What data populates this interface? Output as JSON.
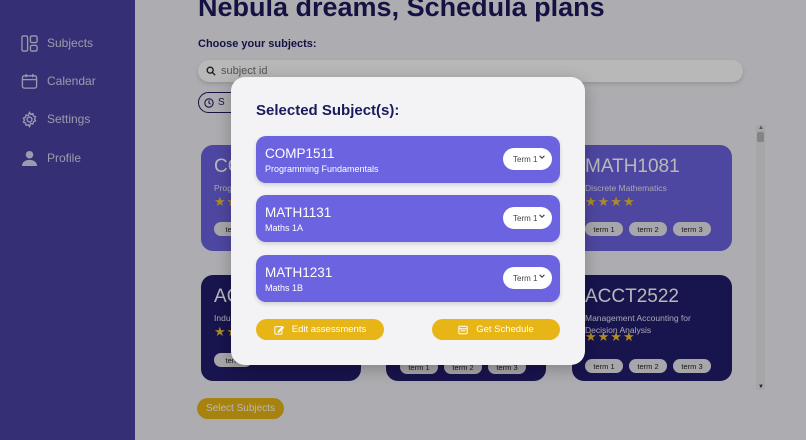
{
  "sidebar": {
    "items": [
      {
        "label": "Subjects",
        "icon": "layout-icon"
      },
      {
        "label": "Calendar",
        "icon": "calendar-icon"
      },
      {
        "label": "Settings",
        "icon": "gear-icon"
      },
      {
        "label": "Profile",
        "icon": "user-icon"
      }
    ]
  },
  "main": {
    "title": "Nebula dreams, Schedula plans",
    "choose_label": "Choose your subjects:",
    "search_placeholder": "subject id",
    "sort_chip_label": "S",
    "select_button": "Select Subjects"
  },
  "cards": [
    {
      "code": "CO",
      "name": "Prog",
      "stars": "★★",
      "terms": [
        "term"
      ]
    },
    {
      "code": "MATH1081",
      "name": "Discrete Mathematics",
      "stars": "★★★★",
      "terms": [
        "term 1",
        "term 2",
        "term 3"
      ]
    },
    {
      "code": "AC",
      "name": "Indu",
      "stars": "★★",
      "terms": [
        "term"
      ]
    },
    {
      "code": "ACCT2522",
      "name": "Management Accounting for Decision Analysis",
      "stars": "★★★★",
      "terms": [
        "term 1",
        "term 2",
        "term 3"
      ]
    },
    {
      "terms": [
        "term 1",
        "term 2",
        "term 3"
      ]
    }
  ],
  "modal": {
    "title": "Selected Subject(s):",
    "subjects": [
      {
        "code": "COMP1511",
        "name": "Programming Fundamentals",
        "term": "Term 1"
      },
      {
        "code": "MATH1131",
        "name": "Maths 1A",
        "term": "Term 1"
      },
      {
        "code": "MATH1231",
        "name": "Maths 1B",
        "term": "Term 1"
      }
    ],
    "edit_button": "Edit assessments",
    "schedule_button": "Get Schedule"
  },
  "colors": {
    "sidebar": "#4a43a3",
    "card_light": "#6c63e0",
    "card_dark": "#221d6b",
    "accent": "#e8b516",
    "title": "#1c1a5e"
  }
}
